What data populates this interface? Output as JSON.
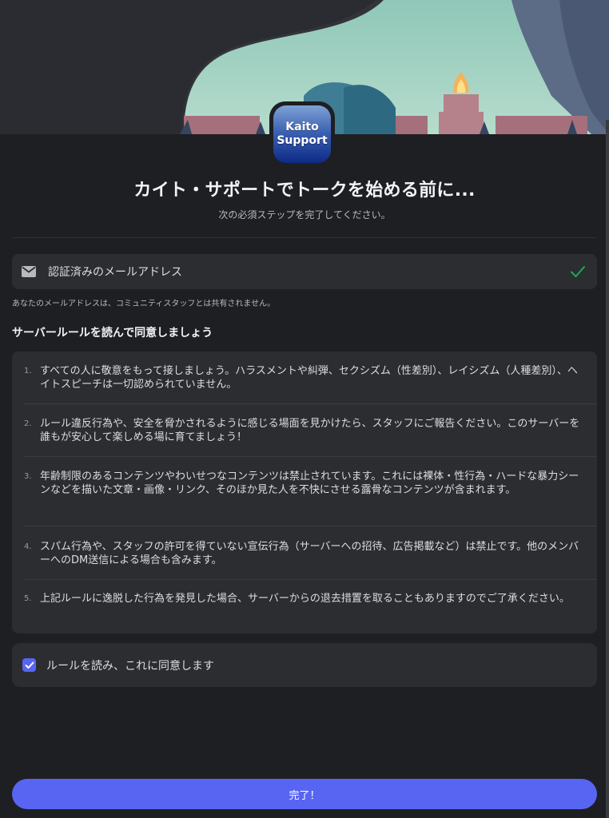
{
  "server": {
    "icon_line1": "Kaito",
    "icon_line2": "Support"
  },
  "header": {
    "title": "カイト・サポートでトークを始める前に...",
    "subtitle": "次の必須ステップを完了してください。"
  },
  "email_step": {
    "icon": "mail-icon",
    "label": "認証済みのメールアドレス",
    "status_icon": "check-icon",
    "verified": true,
    "note": "あなたのメールアドレスは、コミュニティスタッフとは共有されません。"
  },
  "rules": {
    "heading": "サーバールールを読んで同意しましょう",
    "items": [
      {
        "num": "1.",
        "text": "すべての人に敬意をもって接しましょう。ハラスメントや糾弾、セクシズム（性差別）、レイシズム（人種差別）、ヘイトスピーチは一切認められていません。"
      },
      {
        "num": "2.",
        "text": "ルール違反行為や、安全を脅かされるように感じる場面を見かけたら、スタッフにご報告ください。このサーバーを誰もが安心して楽しめる場に育てましょう！"
      },
      {
        "num": "3.",
        "text": "年齢制限のあるコンテンツやわいせつなコンテンツは禁止されています。これには裸体・性行為・ハードな暴力シーンなどを描いた文章・画像・リンク、そのほか見た人を不快にさせる露骨なコンテンツが含まれます。"
      },
      {
        "num": "4.",
        "text": "スパム行為や、スタッフの許可を得ていない宣伝行為（サーバーへの招待、広告掲載など）は禁止です。他のメンバーへのDM送信による場合も含みます。"
      },
      {
        "num": "5.",
        "text": "上記ルールに逸脱した行為を発見した場合、サーバーからの退去措置を取ることもありますのでご了承ください。"
      }
    ]
  },
  "agreement": {
    "label": "ルールを読み、これに同意します",
    "checked": true
  },
  "footer": {
    "finish_label": "完了！"
  },
  "colors": {
    "background": "#1e1f22",
    "card": "#2b2d31",
    "accent": "#5865f2",
    "success": "#23a55a"
  }
}
